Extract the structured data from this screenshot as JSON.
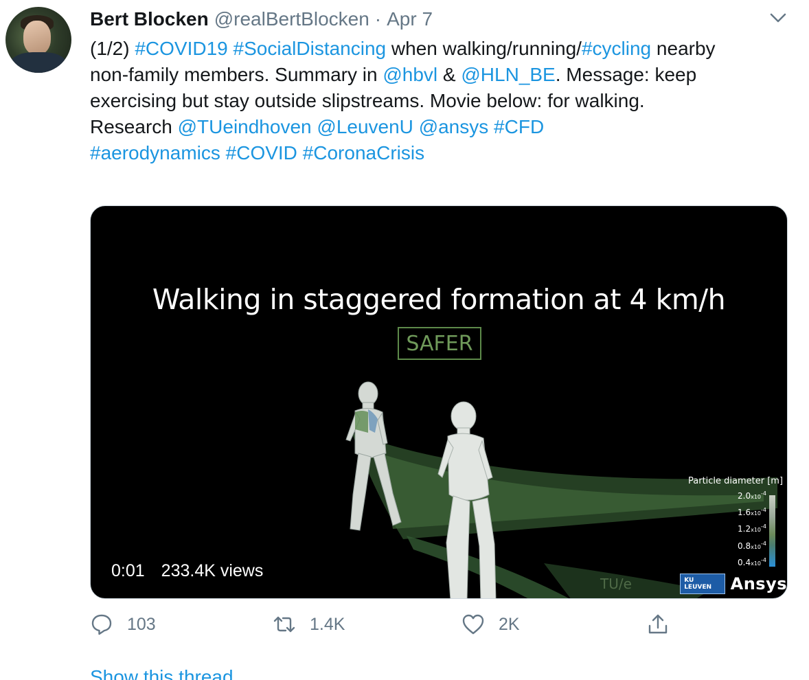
{
  "tweet": {
    "author_name": "Bert Blocken",
    "author_handle": "@realBertBlocken",
    "separator": "·",
    "date": "Apr 7",
    "text_lines": [
      [
        {
          "text": "(1/2) ",
          "link": false
        },
        {
          "text": "#COVID19",
          "link": true
        },
        {
          "text": " ",
          "link": false
        },
        {
          "text": "#SocialDistancing",
          "link": true
        },
        {
          "text": " when walking/running/",
          "link": false
        },
        {
          "text": "#cycling",
          "link": true
        },
        {
          "text": " nearby",
          "link": false
        }
      ],
      [
        {
          "text": "non-family members. Summary in ",
          "link": false
        },
        {
          "text": "@hbvl",
          "link": true
        },
        {
          "text": " & ",
          "link": false
        },
        {
          "text": "@HLN_BE",
          "link": true
        },
        {
          "text": ". Message: keep",
          "link": false
        }
      ],
      [
        {
          "text": "exercising but stay outside slipstreams. Movie below: for walking.",
          "link": false
        }
      ],
      [
        {
          "text": "Research ",
          "link": false
        },
        {
          "text": "@TUeindhoven",
          "link": true
        },
        {
          "text": " ",
          "link": false
        },
        {
          "text": "@LeuvenU",
          "link": true
        },
        {
          "text": " ",
          "link": false
        },
        {
          "text": "@ansys",
          "link": true
        },
        {
          "text": " ",
          "link": false
        },
        {
          "text": "#CFD",
          "link": true
        }
      ],
      [
        {
          "text": " ",
          "link": false
        }
      ],
      [
        {
          "text": "#aerodynamics",
          "link": true
        },
        {
          "text": " ",
          "link": false
        },
        {
          "text": "#COVID",
          "link": true
        },
        {
          "text": " ",
          "link": false
        },
        {
          "text": "#CoronaCrisis",
          "link": true
        }
      ]
    ]
  },
  "media": {
    "video_title": "Walking in staggered formation at 4 km/h",
    "badge": "SAFER",
    "time": "0:01",
    "views": "233.4K views",
    "legend_title": "Particle diameter [m]",
    "legend_ticks": [
      {
        "value": "2.0",
        "unit": "x10",
        "exp": "-4"
      },
      {
        "value": "1.6",
        "unit": "x10",
        "exp": "-4"
      },
      {
        "value": "1.2",
        "unit": "x10",
        "exp": "-4"
      },
      {
        "value": "0.8",
        "unit": "x10",
        "exp": "-4"
      },
      {
        "value": "0.4",
        "unit": "x10",
        "exp": "-4"
      }
    ],
    "logo_tue": "TU/e",
    "logo_kul": "KU LEUVEN",
    "logo_ansys": "Ansys"
  },
  "actions": {
    "reply_count": "103",
    "retweet_count": "1.4K",
    "like_count": "2K"
  },
  "footer": {
    "show_thread": "Show this thread"
  },
  "colors": {
    "link": "#1b95e0",
    "muted": "#657786",
    "text": "#14171a",
    "safer_green": "#5d8a4a"
  },
  "icons": [
    "caret-down-icon",
    "reply-icon",
    "retweet-icon",
    "like-icon",
    "share-icon"
  ]
}
